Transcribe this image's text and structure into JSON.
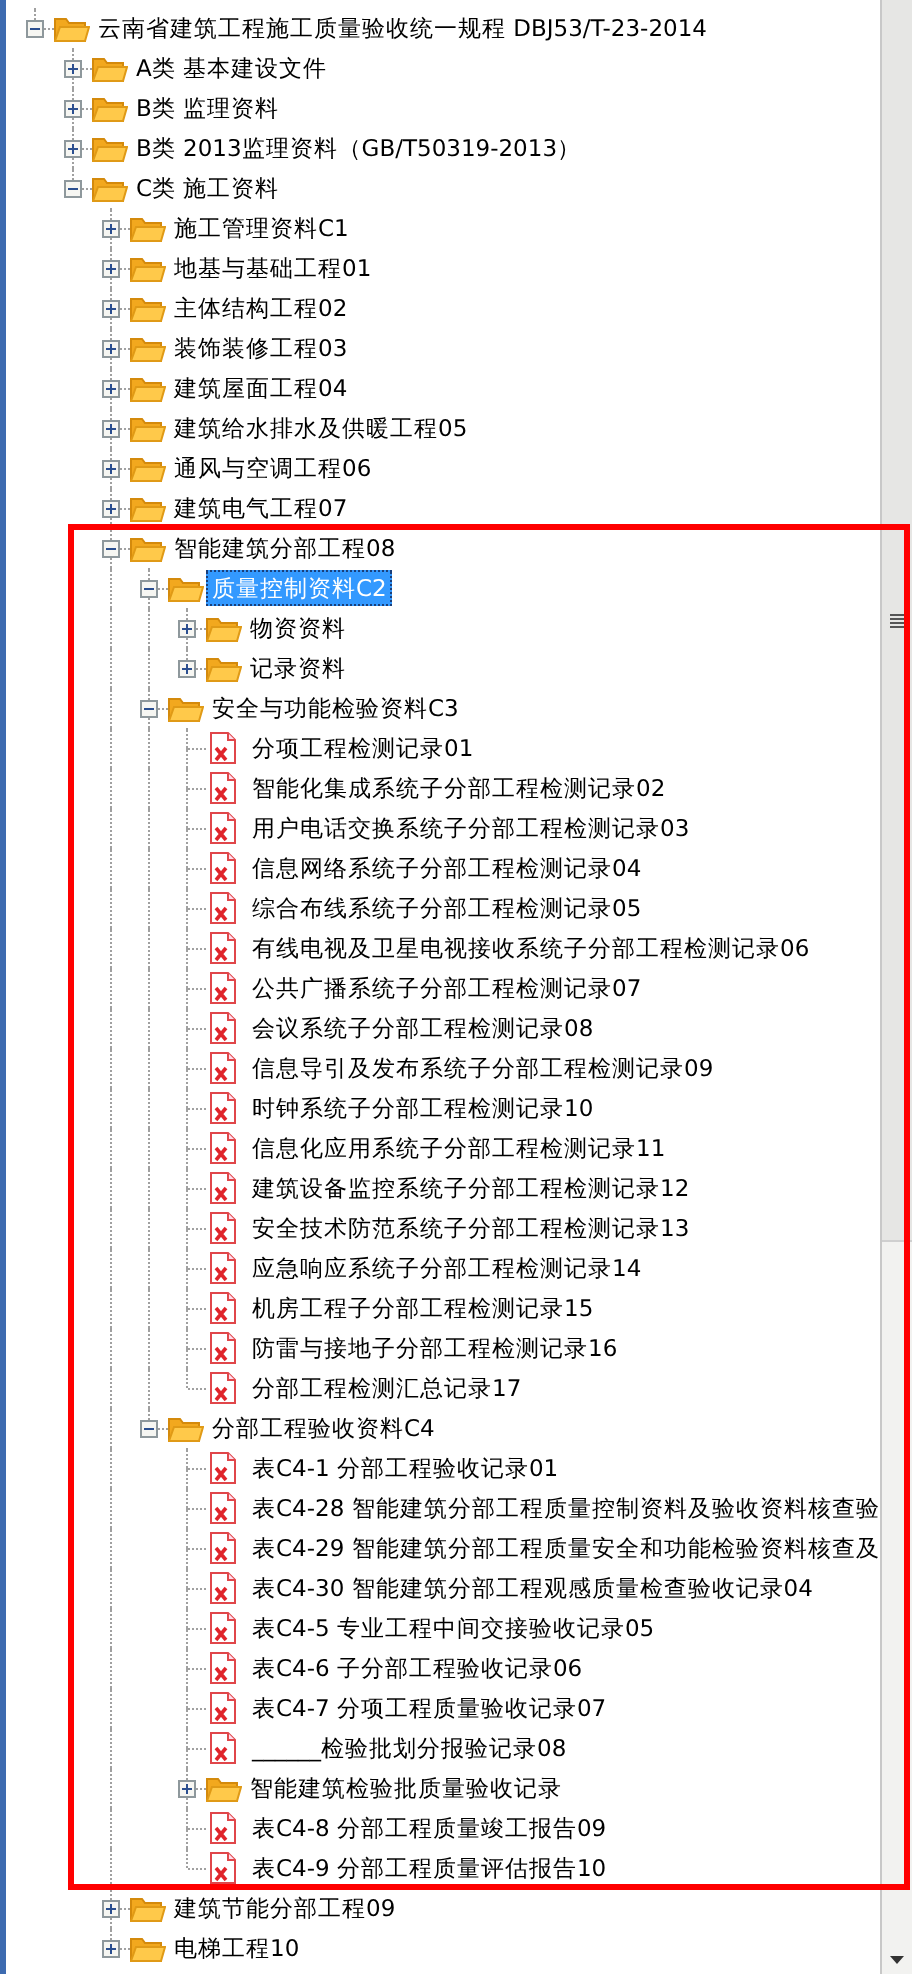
{
  "tree": {
    "items": [
      {
        "kind": "folder",
        "label": "云南省建筑工程施工质量验收统一规程 DBJ53/T-23-2014",
        "expanded": true,
        "selected": false,
        "children": [
          {
            "kind": "folder",
            "label": "A类 基本建设文件",
            "expanded": false,
            "selected": false
          },
          {
            "kind": "folder",
            "label": "B类 监理资料",
            "expanded": false,
            "selected": false
          },
          {
            "kind": "folder",
            "label": "B类 2013监理资料（GB/T50319-2013）",
            "expanded": false,
            "selected": false
          },
          {
            "kind": "folder",
            "label": "C类 施工资料",
            "expanded": true,
            "selected": false,
            "children": [
              {
                "kind": "folder",
                "label": "施工管理资料C1",
                "expanded": false,
                "selected": false
              },
              {
                "kind": "folder",
                "label": "地基与基础工程01",
                "expanded": false,
                "selected": false
              },
              {
                "kind": "folder",
                "label": "主体结构工程02",
                "expanded": false,
                "selected": false
              },
              {
                "kind": "folder",
                "label": "装饰装修工程03",
                "expanded": false,
                "selected": false
              },
              {
                "kind": "folder",
                "label": "建筑屋面工程04",
                "expanded": false,
                "selected": false
              },
              {
                "kind": "folder",
                "label": "建筑给水排水及供暖工程05",
                "expanded": false,
                "selected": false
              },
              {
                "kind": "folder",
                "label": "通风与空调工程06",
                "expanded": false,
                "selected": false
              },
              {
                "kind": "folder",
                "label": "建筑电气工程07",
                "expanded": false,
                "selected": false
              },
              {
                "kind": "folder",
                "label": "智能建筑分部工程08",
                "expanded": true,
                "selected": false,
                "children": [
                  {
                    "kind": "folder",
                    "label": "质量控制资料C2",
                    "expanded": true,
                    "selected": true,
                    "children": [
                      {
                        "kind": "folder",
                        "label": "物资资料",
                        "expanded": false,
                        "selected": false
                      },
                      {
                        "kind": "folder",
                        "label": "记录资料",
                        "expanded": false,
                        "selected": false
                      }
                    ]
                  },
                  {
                    "kind": "folder",
                    "label": "安全与功能检验资料C3",
                    "expanded": true,
                    "selected": false,
                    "children": [
                      {
                        "kind": "file",
                        "label": "分项工程检测记录01",
                        "selected": false
                      },
                      {
                        "kind": "file",
                        "label": "智能化集成系统子分部工程检测记录02",
                        "selected": false
                      },
                      {
                        "kind": "file",
                        "label": "用户电话交换系统子分部工程检测记录03",
                        "selected": false
                      },
                      {
                        "kind": "file",
                        "label": "信息网络系统子分部工程检测记录04",
                        "selected": false
                      },
                      {
                        "kind": "file",
                        "label": "综合布线系统子分部工程检测记录05",
                        "selected": false
                      },
                      {
                        "kind": "file",
                        "label": "有线电视及卫星电视接收系统子分部工程检测记录06",
                        "selected": false
                      },
                      {
                        "kind": "file",
                        "label": "公共广播系统子分部工程检测记录07",
                        "selected": false
                      },
                      {
                        "kind": "file",
                        "label": "会议系统子分部工程检测记录08",
                        "selected": false
                      },
                      {
                        "kind": "file",
                        "label": "信息导引及发布系统子分部工程检测记录09",
                        "selected": false
                      },
                      {
                        "kind": "file",
                        "label": "时钟系统子分部工程检测记录10",
                        "selected": false
                      },
                      {
                        "kind": "file",
                        "label": "信息化应用系统子分部工程检测记录11",
                        "selected": false
                      },
                      {
                        "kind": "file",
                        "label": "建筑设备监控系统子分部工程检测记录12",
                        "selected": false
                      },
                      {
                        "kind": "file",
                        "label": "安全技术防范系统子分部工程检测记录13",
                        "selected": false
                      },
                      {
                        "kind": "file",
                        "label": "应急响应系统子分部工程检测记录14",
                        "selected": false
                      },
                      {
                        "kind": "file",
                        "label": "机房工程子分部工程检测记录15",
                        "selected": false
                      },
                      {
                        "kind": "file",
                        "label": "防雷与接地子分部工程检测记录16",
                        "selected": false
                      },
                      {
                        "kind": "file",
                        "label": "分部工程检测汇总记录17",
                        "selected": false
                      }
                    ]
                  },
                  {
                    "kind": "folder",
                    "label": "分部工程验收资料C4",
                    "expanded": true,
                    "selected": false,
                    "children": [
                      {
                        "kind": "file",
                        "label": "表C4-1 分部工程验收记录01",
                        "selected": false
                      },
                      {
                        "kind": "file",
                        "label": "表C4-28 智能建筑分部工程质量控制资料及验收资料核查验",
                        "selected": false
                      },
                      {
                        "kind": "file",
                        "label": "表C4-29 智能建筑分部工程质量安全和功能检验资料核查及",
                        "selected": false
                      },
                      {
                        "kind": "file",
                        "label": "表C4-30 智能建筑分部工程观感质量检查验收记录04",
                        "selected": false
                      },
                      {
                        "kind": "file",
                        "label": "表C4-5 专业工程中间交接验收记录05",
                        "selected": false
                      },
                      {
                        "kind": "file",
                        "label": "表C4-6 子分部工程验收记录06",
                        "selected": false
                      },
                      {
                        "kind": "file",
                        "label": "表C4-7 分项工程质量验收记录07",
                        "selected": false
                      },
                      {
                        "kind": "file",
                        "label": "______检验批划分报验记录08",
                        "selected": false
                      },
                      {
                        "kind": "folder",
                        "label": "智能建筑检验批质量验收记录",
                        "expanded": false,
                        "selected": false
                      },
                      {
                        "kind": "file",
                        "label": "表C4-8 分部工程质量竣工报告09",
                        "selected": false
                      },
                      {
                        "kind": "file",
                        "label": "表C4-9 分部工程质量评估报告10",
                        "selected": false
                      }
                    ]
                  }
                ]
              },
              {
                "kind": "folder",
                "label": "建筑节能分部工程09",
                "expanded": false,
                "selected": false
              },
              {
                "kind": "folder",
                "label": "电梯工程10",
                "expanded": false,
                "selected": false
              }
            ]
          }
        ]
      }
    ]
  }
}
